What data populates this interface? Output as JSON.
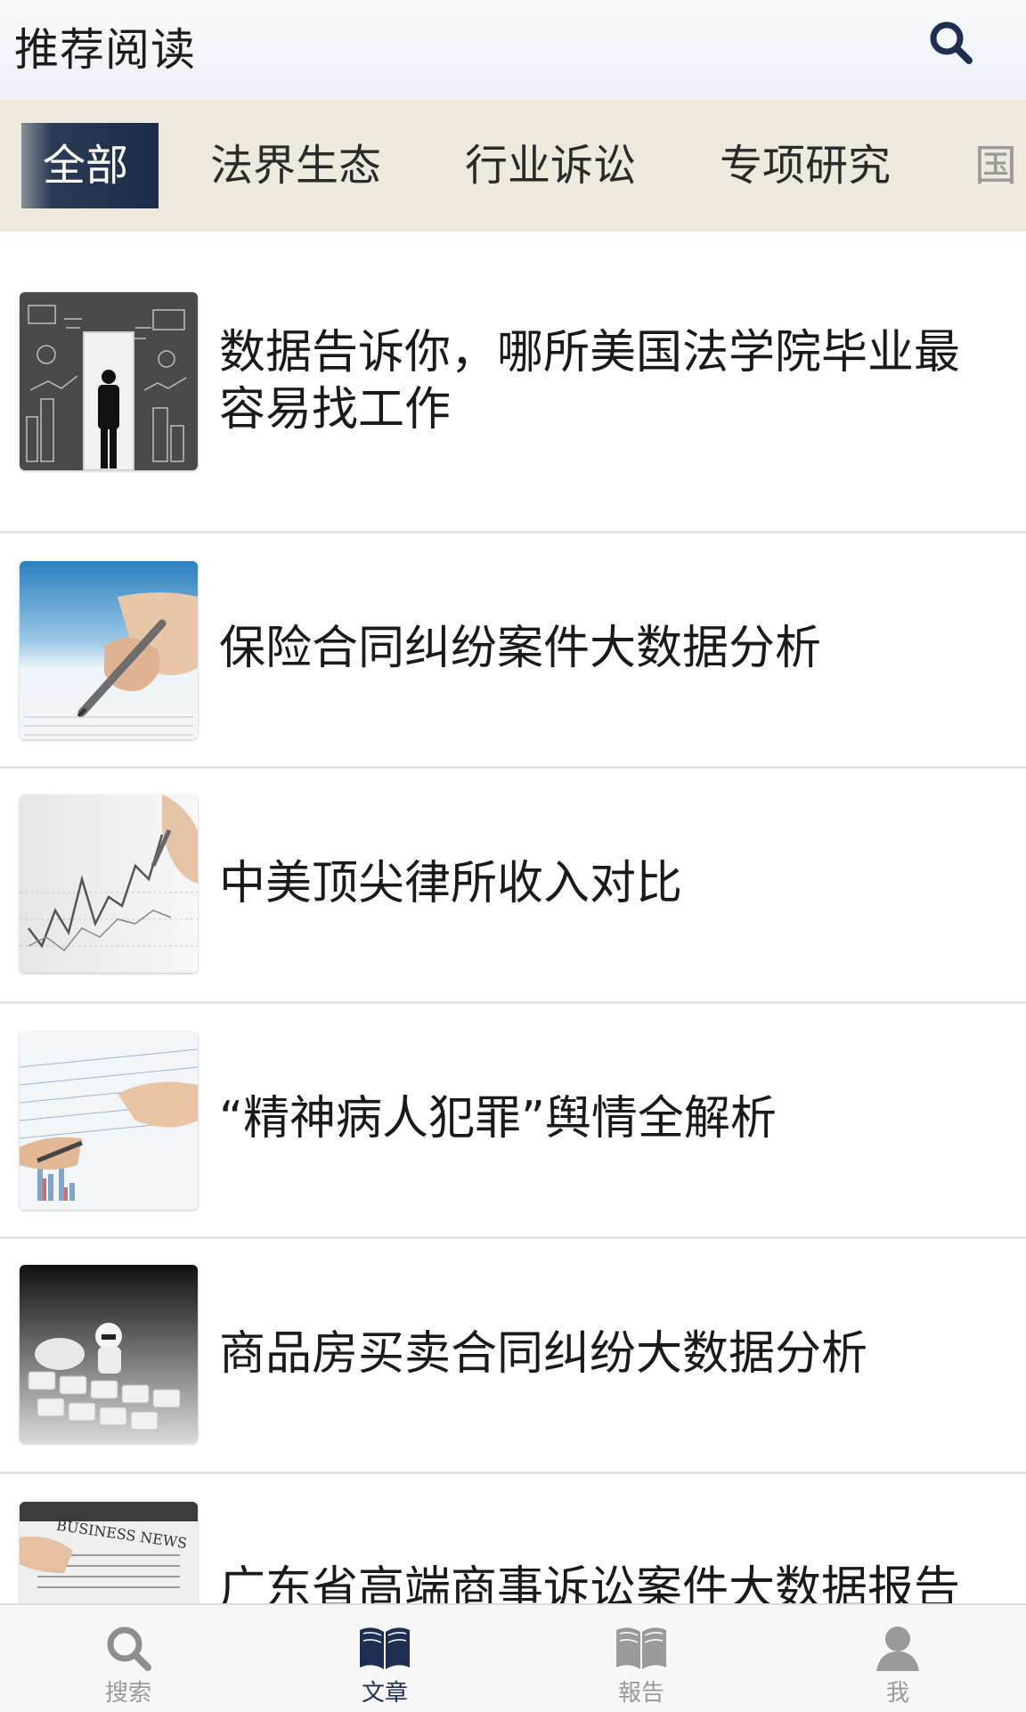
{
  "header": {
    "title": "推荐阅读",
    "search_icon": "search-icon"
  },
  "tabs": [
    {
      "label": "全部",
      "active": true
    },
    {
      "label": "法界生态"
    },
    {
      "label": "行业诉讼"
    },
    {
      "label": "专项研究"
    },
    {
      "label": "国"
    }
  ],
  "articles": [
    {
      "title": "数据告诉你，哪所美国法学院毕业最容易找工作",
      "thumb": "chalkboard-city-image"
    },
    {
      "title": "保险合同纠纷案件大数据分析",
      "thumb": "pen-writing-image"
    },
    {
      "title": "中美顶尖律所收入对比",
      "thumb": "line-chart-drawing-image"
    },
    {
      "title": "“精神病人犯罪”舆情全解析",
      "thumb": "handshake-chart-image"
    },
    {
      "title": "商品房买卖合同纠纷大数据分析",
      "thumb": "keyboard-toy-image"
    },
    {
      "title": "广东省高端商事诉讼案件大数据报告",
      "thumb": "business-news-image"
    }
  ],
  "bottom_nav": [
    {
      "label": "搜索",
      "icon": "search-icon"
    },
    {
      "label": "文章",
      "icon": "book-icon",
      "active": true
    },
    {
      "label": "報告",
      "icon": "book-icon"
    },
    {
      "label": "我",
      "icon": "user-icon"
    }
  ],
  "colors": {
    "accent": "#1e2f52",
    "tab_bar": "#ede9dd",
    "inactive": "#9a9a9a"
  }
}
